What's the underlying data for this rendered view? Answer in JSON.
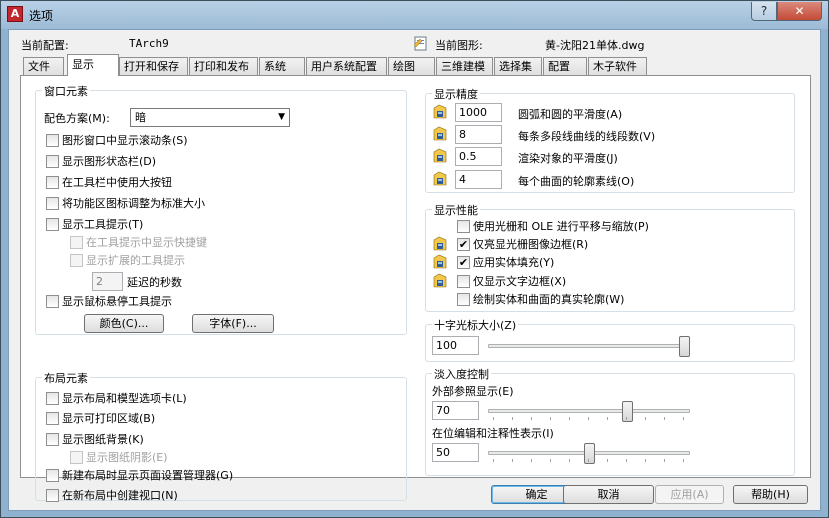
{
  "window": {
    "title": "选项",
    "help": "?",
    "close": "✕"
  },
  "header": {
    "current_profile_label": "当前配置:",
    "current_profile_value": "TArch9",
    "current_drawing_label": "当前图形:",
    "current_drawing_value": "黄-沈阳21单体.dwg"
  },
  "tabs": [
    "文件",
    "显示",
    "打开和保存",
    "打印和发布",
    "系统",
    "用户系统配置",
    "绘图",
    "三维建模",
    "选择集",
    "配置",
    "木子软件"
  ],
  "window_elements": {
    "title": "窗口元素",
    "color_scheme_label": "配色方案(M):",
    "color_scheme_value": "暗",
    "checkboxes": [
      "图形窗口中显示滚动条(S)",
      "显示图形状态栏(D)",
      "在工具栏中使用大按钮",
      "将功能区图标调整为标准大小",
      "显示工具提示(T)"
    ],
    "tooltip_shortcut": "在工具提示中显示快捷键",
    "tooltip_extended": "显示扩展的工具提示",
    "delay_value": "2",
    "delay_label": "延迟的秒数",
    "rollover": "显示鼠标悬停工具提示",
    "colors_button": "颜色(C)...",
    "fonts_button": "字体(F)..."
  },
  "layout_elements": {
    "title": "布局元素",
    "items": [
      "显示布局和模型选项卡(L)",
      "显示可打印区域(B)",
      "显示图纸背景(K)"
    ],
    "paper_shadow": "显示图纸阴影(E)",
    "page_setup": "新建布局时显示页面设置管理器(G)",
    "viewport": "在新布局中创建视口(N)"
  },
  "display_resolution": {
    "title": "显示精度",
    "items": [
      {
        "value": "1000",
        "label": "圆弧和圆的平滑度(A)"
      },
      {
        "value": "8",
        "label": "每条多段线曲线的线段数(V)"
      },
      {
        "value": "0.5",
        "label": "渲染对象的平滑度(J)"
      },
      {
        "value": "4",
        "label": "每个曲面的轮廓素线(O)"
      }
    ]
  },
  "display_performance": {
    "title": "显示性能",
    "items": [
      {
        "label": "使用光栅和 OLE 进行平移与缩放(P)",
        "checked": false
      },
      {
        "label": "仅亮显光栅图像边框(R)",
        "checked": true
      },
      {
        "label": "应用实体填充(Y)",
        "checked": true
      },
      {
        "label": "仅显示文字边框(X)",
        "checked": false
      },
      {
        "label": "绘制实体和曲面的真实轮廓(W)",
        "checked": false
      }
    ]
  },
  "crosshair": {
    "title": "十字光标大小(Z)",
    "value": "100",
    "slider_level": 1.0
  },
  "fade": {
    "title": "淡入度控制",
    "xref_label": "外部参照显示(E)",
    "xref_value": "70",
    "inplace_label": "在位编辑和注释性表示(I)",
    "inplace_value": "50"
  },
  "buttons": {
    "ok": "确定",
    "cancel": "取消",
    "apply": "应用(A)",
    "help": "帮助(H)"
  },
  "colors": {
    "accent": "#3c7fb1",
    "titlebar": "#9dbbd6",
    "close": "#c44a36"
  }
}
